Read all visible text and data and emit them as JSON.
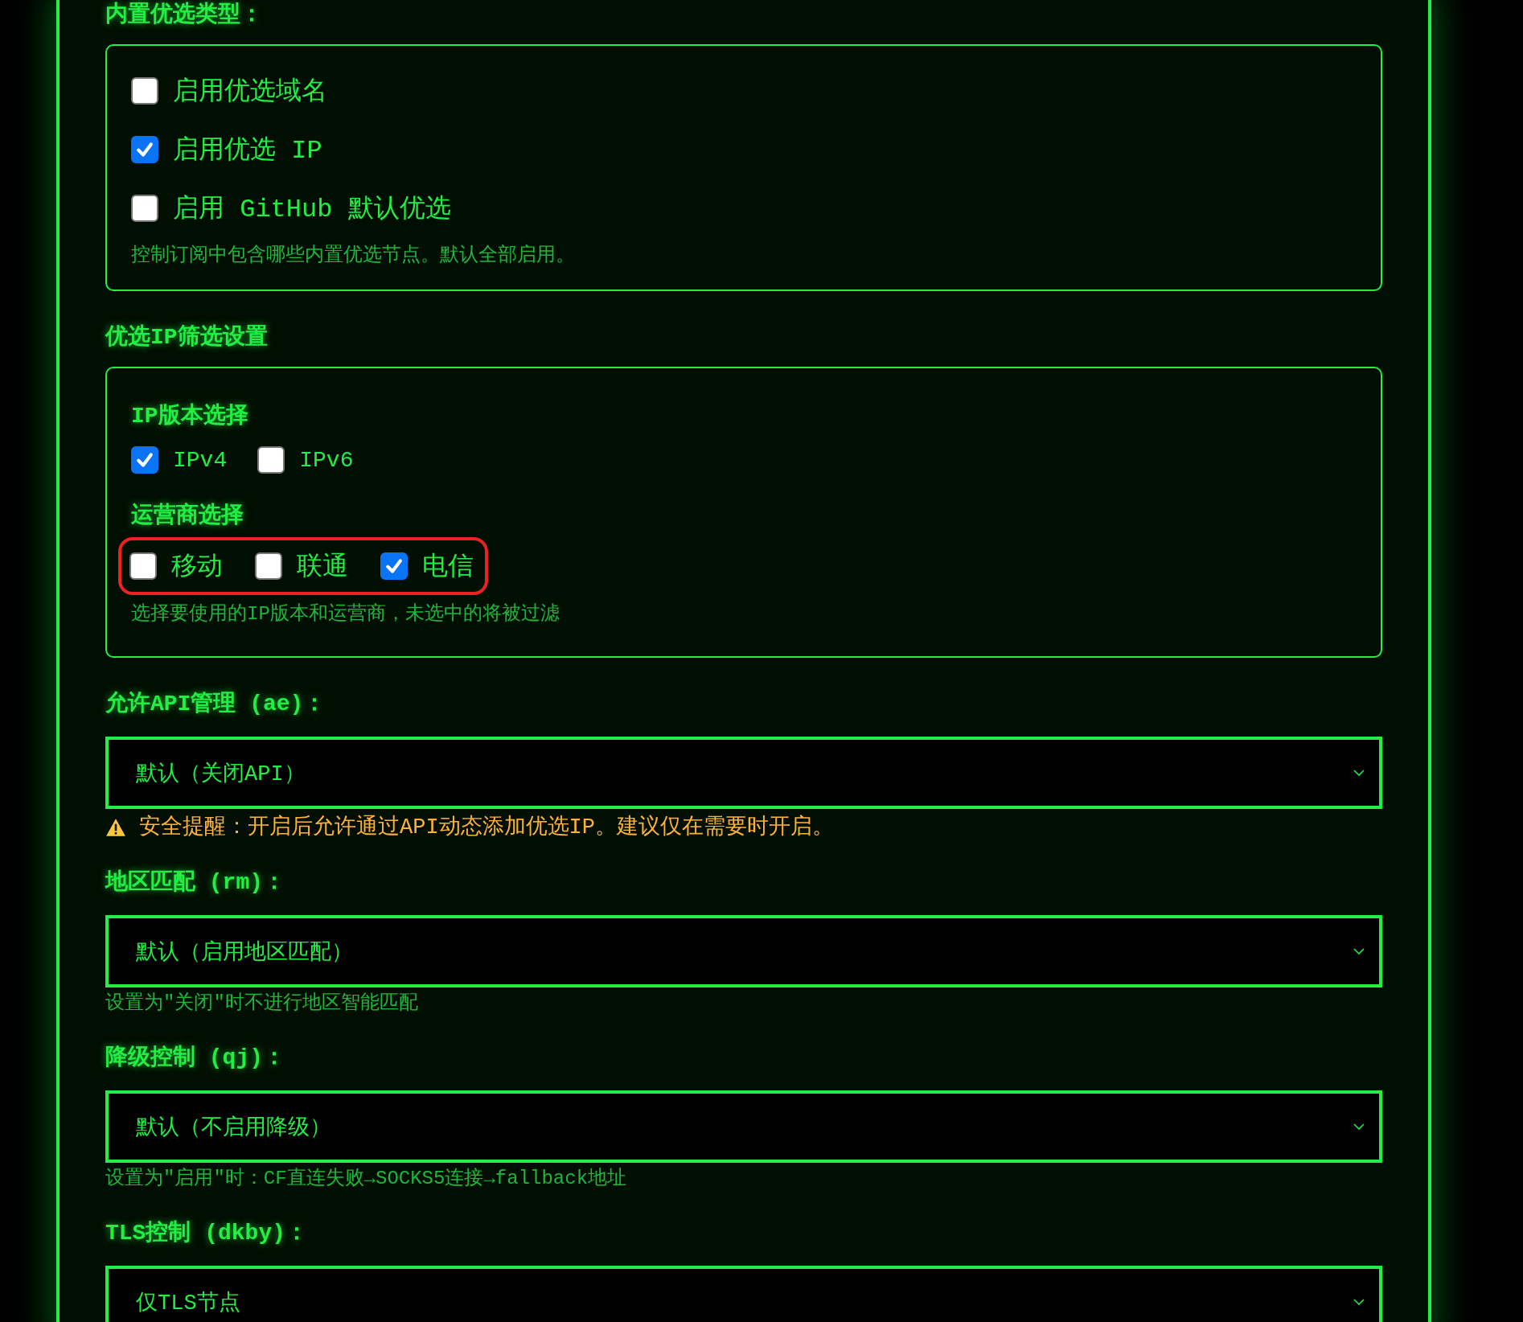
{
  "sections": [
    {
      "kind": "checkbox_box",
      "title": "内置优选类型：",
      "options": [
        {
          "label": "启用优选域名",
          "checked": false
        },
        {
          "label": "启用优选 IP",
          "checked": true
        },
        {
          "label": "启用 GitHub 默认优选",
          "checked": false
        }
      ],
      "hint": "控制订阅中包含哪些内置优选节点。默认全部启用。"
    },
    {
      "kind": "filter_box",
      "title": "优选IP筛选设置",
      "groups": [
        {
          "title": "IP版本选择",
          "highlighted": false,
          "options": [
            {
              "label": "IPv4",
              "checked": true
            },
            {
              "label": "IPv6",
              "checked": false
            }
          ]
        },
        {
          "title": "运营商选择",
          "highlighted": true,
          "options": [
            {
              "label": "移动",
              "checked": false
            },
            {
              "label": "联通",
              "checked": false
            },
            {
              "label": "电信",
              "checked": true
            }
          ]
        }
      ],
      "hint": "选择要使用的IP版本和运营商，未选中的将被过滤"
    },
    {
      "kind": "select",
      "title": "允许API管理 (ae)：",
      "value": "默认（关闭API）",
      "warning": "安全提醒：开启后允许通过API动态添加优选IP。建议仅在需要时开启。"
    },
    {
      "kind": "select",
      "title": "地区匹配 (rm)：",
      "value": "默认（启用地区匹配）",
      "hint": "设置为\"关闭\"时不进行地区智能匹配"
    },
    {
      "kind": "select",
      "title": "降级控制 (qj)：",
      "value": "默认（不启用降级）",
      "hint": "设置为\"启用\"时：CF直连失败→SOCKS5连接→fallback地址"
    },
    {
      "kind": "select",
      "title": "TLS控制 (dkby)：",
      "value": "仅TLS节点"
    }
  ]
}
